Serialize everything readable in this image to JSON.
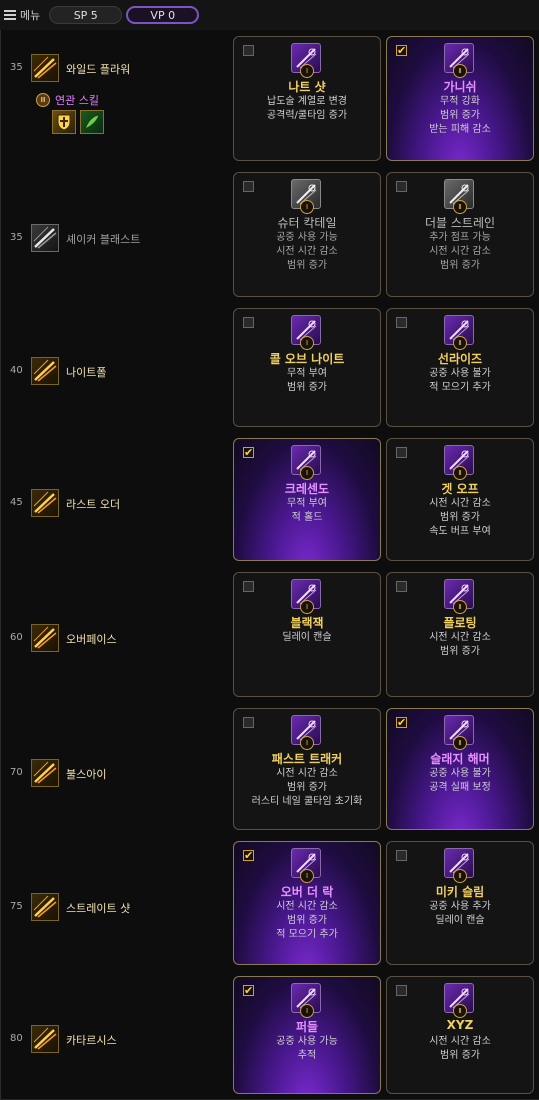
{
  "topbar": {
    "menu_label": "메뉴",
    "sp_label": "SP 5",
    "vp_label": "VP 0"
  },
  "rows": [
    {
      "level": "35",
      "name": "와일드 플라워",
      "icon": "wild-flower-icon",
      "grey": false,
      "assoc": {
        "badge": "Ⅲ",
        "label": "연관 스킬",
        "icons": [
          "shield-cross-icon",
          "green-leaf-icon"
        ]
      },
      "options": [
        {
          "tier": "Ⅰ",
          "name": "나트 샷",
          "desc": [
            "납도술 계열로 변경",
            "공격력/쿨타임 증가"
          ],
          "checked": false
        },
        {
          "tier": "Ⅱ",
          "name": "가니쉬",
          "desc": [
            "무적 강화",
            "범위 증가",
            "받는 피해 감소"
          ],
          "checked": true
        }
      ]
    },
    {
      "level": "35",
      "name": "셰이커 블래스트",
      "icon": "shaker-blast-icon",
      "grey": true,
      "options": [
        {
          "tier": "Ⅰ",
          "name": "슈터 칵테일",
          "desc": [
            "공중 사용 가능",
            "시전 시간 감소",
            "범위 증가"
          ],
          "checked": false
        },
        {
          "tier": "Ⅱ",
          "name": "더블 스트레인",
          "desc": [
            "추가 점프 가능",
            "시전 시간 감소",
            "범위 증가"
          ],
          "checked": false
        }
      ]
    },
    {
      "level": "40",
      "name": "나이트폴",
      "icon": "nightfall-icon",
      "grey": false,
      "options": [
        {
          "tier": "Ⅰ",
          "name": "콜 오브 나이트",
          "desc": [
            "무적 부여",
            "범위 증가"
          ],
          "checked": false
        },
        {
          "tier": "Ⅱ",
          "name": "선라이즈",
          "desc": [
            "공중 사용 불가",
            "적 모으기 추가"
          ],
          "checked": false
        }
      ]
    },
    {
      "level": "45",
      "name": "라스트 오더",
      "icon": "last-order-icon",
      "grey": false,
      "options": [
        {
          "tier": "Ⅰ",
          "name": "크레센도",
          "desc": [
            "무적 부여",
            "적 홀드"
          ],
          "checked": true
        },
        {
          "tier": "Ⅱ",
          "name": "겟 오프",
          "desc": [
            "시전 시간 감소",
            "범위 증가",
            "속도 버프 부여"
          ],
          "checked": false
        }
      ]
    },
    {
      "level": "60",
      "name": "오버페이스",
      "icon": "overpace-icon",
      "grey": false,
      "options": [
        {
          "tier": "Ⅰ",
          "name": "블랙잭",
          "desc": [
            "딜레이 캔슬"
          ],
          "checked": false
        },
        {
          "tier": "Ⅱ",
          "name": "플로팅",
          "desc": [
            "시전 시간 감소",
            "범위 증가"
          ],
          "checked": false
        }
      ]
    },
    {
      "level": "70",
      "name": "불스아이",
      "icon": "bullseye-icon",
      "grey": false,
      "options": [
        {
          "tier": "Ⅰ",
          "name": "패스트 트래커",
          "desc": [
            "시전 시간 감소",
            "범위 증가",
            "러스티 네일 쿨타임 초기화"
          ],
          "checked": false
        },
        {
          "tier": "Ⅱ",
          "name": "슬래지 해머",
          "desc": [
            "공중 사용 불가",
            "공격 실패 보정"
          ],
          "checked": true
        }
      ]
    },
    {
      "level": "75",
      "name": "스트레이트 샷",
      "icon": "straight-shot-icon",
      "grey": false,
      "options": [
        {
          "tier": "Ⅰ",
          "name": "오버 더 락",
          "desc": [
            "시전 시간 감소",
            "범위 증가",
            "적 모으기 추가"
          ],
          "checked": true
        },
        {
          "tier": "Ⅱ",
          "name": "미키 슬림",
          "desc": [
            "공중 사용 추가",
            "딜레이 캔슬"
          ],
          "checked": false
        }
      ]
    },
    {
      "level": "80",
      "name": "카타르시스",
      "icon": "catharsis-icon",
      "grey": false,
      "options": [
        {
          "tier": "Ⅰ",
          "name": "퍼들",
          "desc": [
            "공중 사용 가능",
            "추적"
          ],
          "checked": true
        },
        {
          "tier": "Ⅱ",
          "name": "XYZ",
          "desc": [
            "시전 시간 감소",
            "범위 증가"
          ],
          "checked": false
        }
      ]
    }
  ],
  "colors": {
    "accent_gold": "#f2d060",
    "selected_purple": "#7a2ad0",
    "vp_border": "#7d55c0"
  }
}
